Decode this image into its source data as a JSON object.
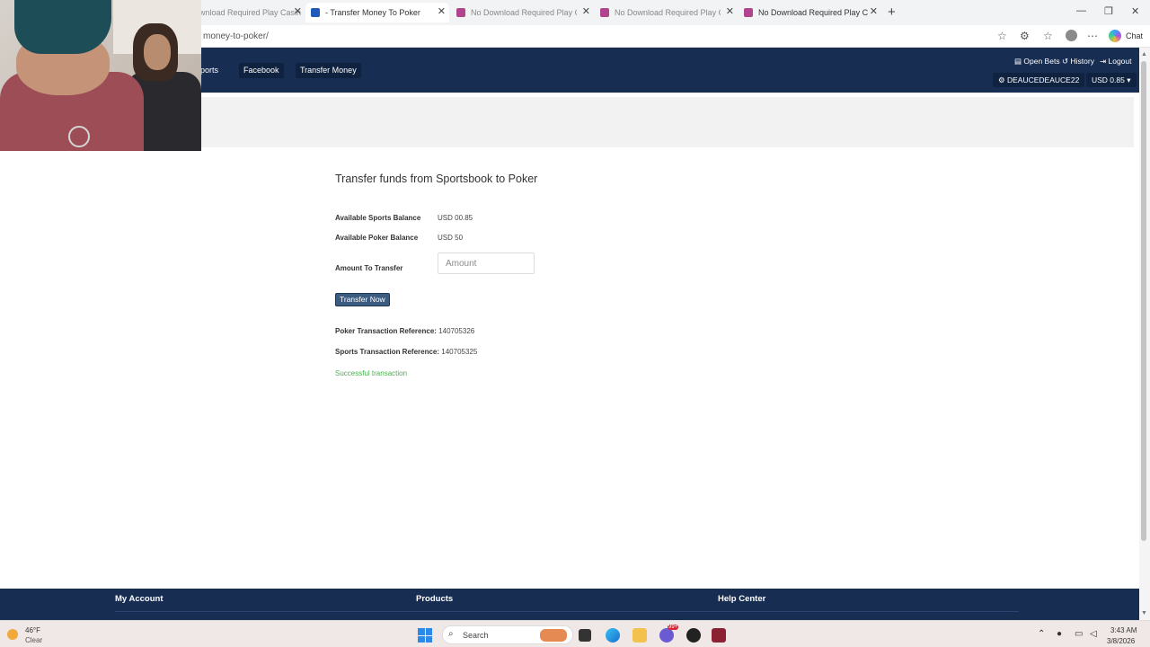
{
  "browser": {
    "tabs": [
      {
        "title": "wnload Required Play Casin",
        "active": false
      },
      {
        "title": "- Transfer Money To Poker",
        "active": true
      },
      {
        "title": "No Download Required Play Casin",
        "active": false
      },
      {
        "title": "No Download Required Play Casin",
        "active": false
      },
      {
        "title": "No Download Required Play Casin",
        "active": false
      }
    ],
    "url": "money-to-poker/",
    "copilot_label": "Chat",
    "close_glyph": "✕",
    "new_tab_glyph": "+",
    "window_controls": [
      "—",
      "❐",
      "✕"
    ]
  },
  "site": {
    "nav": [
      "ports",
      "Facebook",
      "Transfer Money"
    ],
    "top_links": {
      "open_bets": "Open Bets",
      "history": "History",
      "logout": "Logout"
    },
    "username": "DEAUCEDEAUCE22",
    "balance_dropdown": "USD 0.85"
  },
  "main": {
    "title": "Transfer funds from Sportsbook to Poker",
    "available_sports_label": "Available Sports Balance",
    "available_sports_value": "USD 00.85",
    "available_poker_label": "Available Poker Balance",
    "available_poker_value": "USD 50",
    "amount_label": "Amount To Transfer",
    "amount_placeholder": "Amount",
    "transfer_button": "Transfer Now",
    "poker_ref_label": "Poker Transaction Reference:",
    "poker_ref_value": "140705326",
    "sports_ref_label": "Sports Transaction Reference:",
    "sports_ref_value": "140705325",
    "status": "Successful transaction"
  },
  "footer": {
    "my_account": "My Account",
    "products": "Products",
    "help_center": "Help Center"
  },
  "taskbar": {
    "weather_temp": "46°F",
    "weather_condition": "Clear",
    "search_label": "Search",
    "time": "3:43 AM",
    "date": "3/8/2026",
    "notification_badge": "99+"
  },
  "colors": {
    "header_navy": "#172d52",
    "button_blue": "#3b5b80",
    "success_green": "#4caf50"
  }
}
